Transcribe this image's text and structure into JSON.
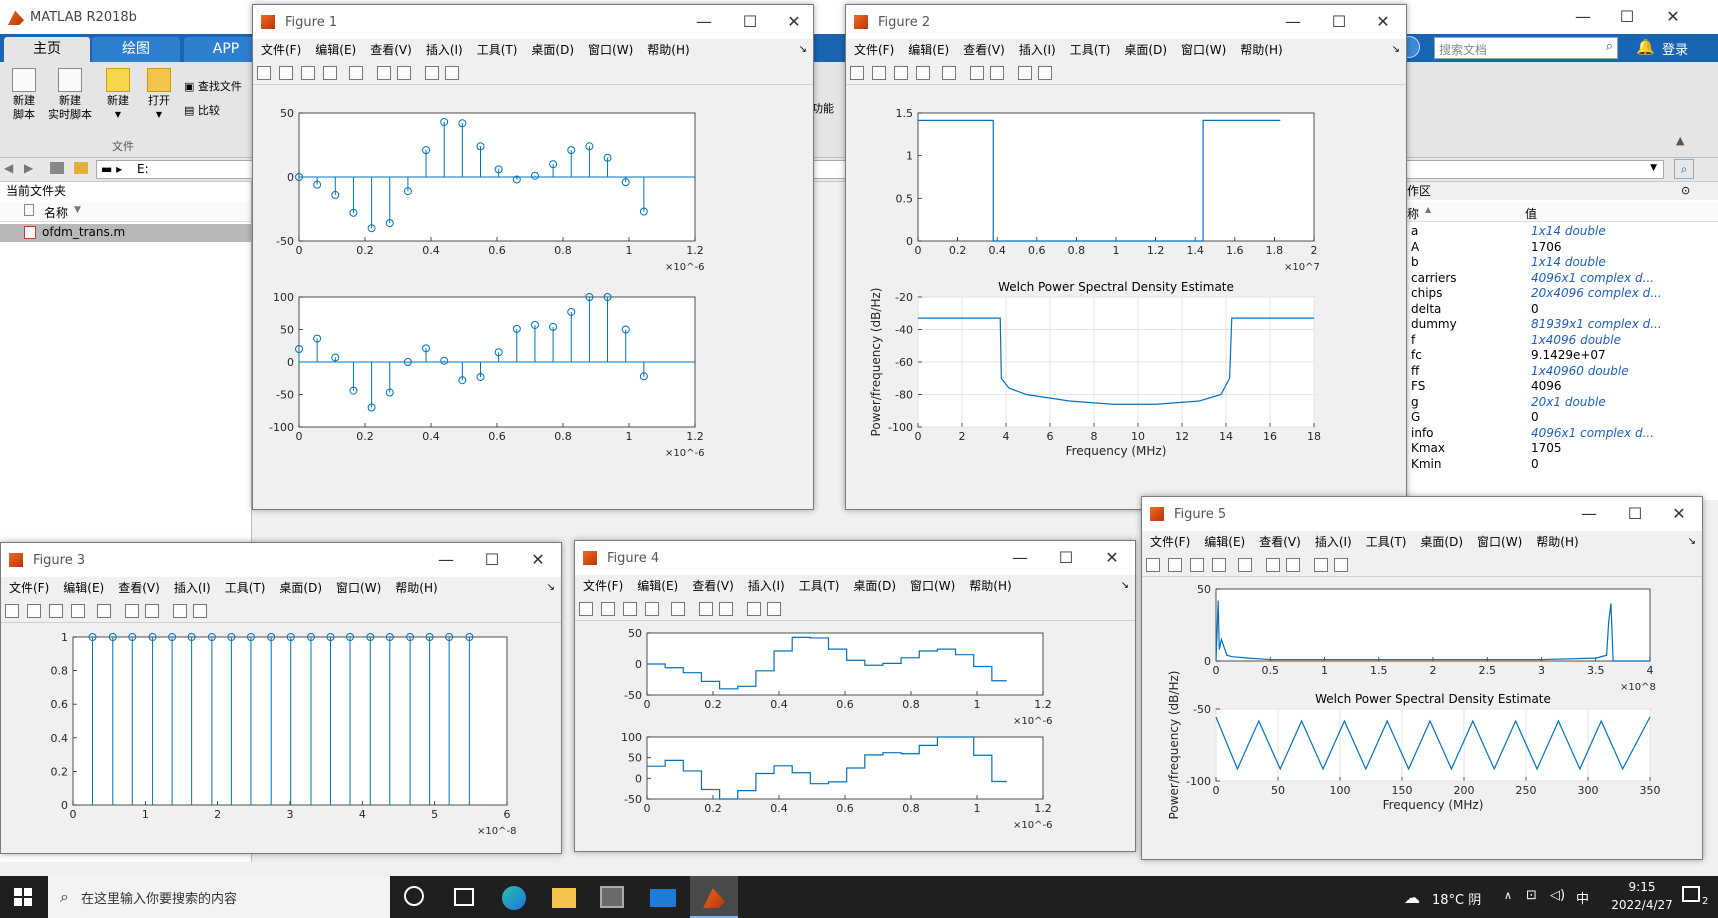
{
  "main": {
    "title": "MATLAB R2018b",
    "tabs": [
      "主页",
      "绘图",
      "APP"
    ],
    "ribbon": {
      "new_script": "新建\n脚本",
      "new_live": "新建\n实时脚本",
      "new": "新建",
      "open": "打开",
      "find_files": "查找文件",
      "compare": "比较",
      "section_file": "文件",
      "func_label": "功能"
    },
    "search_placeholder": "搜索文档",
    "login": "登录",
    "address": "E:",
    "current_folder": "当前文件夹",
    "col_name": "名称",
    "file": "ofdm_trans.m",
    "workspace": {
      "title": "作区",
      "col_name": "称",
      "col_value": "值",
      "rows": [
        {
          "n": "a",
          "v": "1x14 double",
          "it": true
        },
        {
          "n": "A",
          "v": "1706",
          "it": false
        },
        {
          "n": "b",
          "v": "1x14 double",
          "it": true
        },
        {
          "n": "carriers",
          "v": "4096x1 complex d...",
          "it": true
        },
        {
          "n": "chips",
          "v": "20x4096 complex d...",
          "it": true
        },
        {
          "n": "delta",
          "v": "0",
          "it": false
        },
        {
          "n": "dummy",
          "v": "81939x1 complex d...",
          "it": true
        },
        {
          "n": "f",
          "v": "1x4096 double",
          "it": true
        },
        {
          "n": "fc",
          "v": "9.1429e+07",
          "it": false
        },
        {
          "n": "ff",
          "v": "1x40960 double",
          "it": true
        },
        {
          "n": "FS",
          "v": "4096",
          "it": false
        },
        {
          "n": "g",
          "v": "20x1 double",
          "it": true
        },
        {
          "n": "G",
          "v": "0",
          "it": false
        },
        {
          "n": "info",
          "v": "4096x1 complex d...",
          "it": true
        },
        {
          "n": "Kmax",
          "v": "1705",
          "it": false
        },
        {
          "n": "Kmin",
          "v": "0",
          "it": false
        }
      ]
    }
  },
  "menu": [
    "文件(F)",
    "编辑(E)",
    "查看(V)",
    "插入(I)",
    "工具(T)",
    "桌面(D)",
    "窗口(W)",
    "帮助(H)"
  ],
  "figures": {
    "f1": {
      "title": "Figure 1"
    },
    "f2": {
      "title": "Figure 2"
    },
    "f3": {
      "title": "Figure 3"
    },
    "f4": {
      "title": "Figure 4"
    },
    "f5": {
      "title": "Figure 5"
    }
  },
  "taskbar": {
    "search_placeholder": "在这里输入你要搜索的内容",
    "weather": "18°C 阴",
    "ime": "中",
    "time": "9:15",
    "date": "2022/4/27",
    "notify": "2"
  },
  "chart_data": [
    {
      "type": "stem",
      "figure": "Figure 1",
      "panel": "top",
      "xlim": [
        0,
        1.2
      ],
      "ylim": [
        -50,
        50
      ],
      "x_exponent": "×10^-6",
      "xticks": [
        "0",
        "0.2",
        "0.4",
        "0.6",
        "0.8",
        "1",
        "1.2"
      ],
      "yticks": [
        "50",
        "0",
        "-50"
      ],
      "x": [
        0,
        0.055,
        0.11,
        0.165,
        0.22,
        0.275,
        0.33,
        0.385,
        0.44,
        0.495,
        0.55,
        0.605,
        0.66,
        0.715,
        0.77,
        0.825,
        0.88,
        0.935,
        0.99,
        1.045
      ],
      "values": [
        0,
        -6,
        -14,
        -28,
        -40,
        -36,
        -11,
        21,
        43,
        42,
        24,
        6,
        -2,
        1,
        10,
        21,
        24,
        15,
        -4,
        -27
      ]
    },
    {
      "type": "stem",
      "figure": "Figure 1",
      "panel": "bottom",
      "xlim": [
        0,
        1.2
      ],
      "ylim": [
        -100,
        100
      ],
      "x_exponent": "×10^-6",
      "xticks": [
        "0",
        "0.2",
        "0.4",
        "0.6",
        "0.8",
        "1",
        "1.2"
      ],
      "yticks": [
        "100",
        "50",
        "0",
        "-50",
        "-100"
      ],
      "x": [
        0,
        0.055,
        0.11,
        0.165,
        0.22,
        0.275,
        0.33,
        0.385,
        0.44,
        0.495,
        0.55,
        0.605,
        0.66,
        0.715,
        0.77,
        0.825,
        0.88,
        0.935,
        0.99,
        1.045
      ],
      "values": [
        20,
        36,
        7,
        -44,
        -70,
        -47,
        0,
        21,
        2,
        -28,
        -23,
        15,
        51,
        57,
        54,
        77,
        109,
        106,
        50,
        -22
      ]
    },
    {
      "type": "line",
      "figure": "Figure 2",
      "panel": "top",
      "xlim": [
        0,
        2
      ],
      "ylim": [
        0,
        1.5
      ],
      "x_exponent": "×10^7",
      "xticks": [
        "0",
        "0.2",
        "0.4",
        "0.6",
        "0.8",
        "1",
        "1.2",
        "1.4",
        "1.6",
        "1.8",
        "2"
      ],
      "yticks": [
        "1.5",
        "1",
        "0.5",
        "0"
      ],
      "x": [
        0,
        0.38,
        0.38,
        1.44,
        1.44,
        1.83
      ],
      "values": [
        1.414,
        1.414,
        0,
        0,
        1.414,
        1.414
      ]
    },
    {
      "type": "line",
      "figure": "Figure 2",
      "panel": "bottom",
      "title": "Welch Power Spectral Density Estimate",
      "xlabel": "Frequency (MHz)",
      "ylabel": "Power/frequency (dB/Hz)",
      "xlim": [
        0,
        18.3
      ],
      "ylim": [
        -100,
        -20
      ],
      "grid": true,
      "xticks": [
        "0",
        "2",
        "4",
        "6",
        "8",
        "10",
        "12",
        "14",
        "16",
        "18"
      ],
      "yticks": [
        "-20",
        "-40",
        "-60",
        "-80",
        "-100"
      ],
      "x": [
        0,
        3.8,
        3.85,
        4.2,
        5,
        7,
        9,
        11,
        13,
        14,
        14.4,
        14.5,
        18.3
      ],
      "values": [
        -33,
        -33,
        -70,
        -76,
        -80,
        -84,
        -86,
        -86,
        -84,
        -80,
        -70,
        -33,
        -33
      ]
    },
    {
      "type": "stem",
      "figure": "Figure 3",
      "xlim": [
        0,
        6
      ],
      "ylim": [
        0,
        1
      ],
      "x_exponent": "×10^-8",
      "xticks": [
        "0",
        "1",
        "2",
        "3",
        "4",
        "5",
        "6"
      ],
      "yticks": [
        "1",
        "0.8",
        "0.6",
        "0.4",
        "0.2",
        "0"
      ],
      "x": [
        0.27,
        0.55,
        0.82,
        1.1,
        1.37,
        1.64,
        1.92,
        2.19,
        2.46,
        2.74,
        3.01,
        3.29,
        3.56,
        3.83,
        4.11,
        4.38,
        4.66,
        4.93,
        5.2,
        5.48
      ],
      "values": [
        1,
        1,
        1,
        1,
        1,
        1,
        1,
        1,
        1,
        1,
        1,
        1,
        1,
        1,
        1,
        1,
        1,
        1,
        1,
        1
      ]
    },
    {
      "type": "stairs",
      "figure": "Figure 4",
      "panel": "top",
      "xlim": [
        0,
        1.2
      ],
      "ylim": [
        -50,
        50
      ],
      "x_exponent": "×10^-6",
      "xticks": [
        "0",
        "0.2",
        "0.4",
        "0.6",
        "0.8",
        "1",
        "1.2"
      ],
      "yticks": [
        "50",
        "0",
        "-50"
      ],
      "x": [
        0,
        0.055,
        0.11,
        0.165,
        0.22,
        0.275,
        0.33,
        0.385,
        0.44,
        0.495,
        0.55,
        0.605,
        0.66,
        0.715,
        0.77,
        0.825,
        0.88,
        0.935,
        0.99,
        1.045,
        1.09
      ],
      "values": [
        0,
        -6,
        -14,
        -28,
        -40,
        -36,
        -11,
        21,
        43,
        42,
        24,
        6,
        -2,
        1,
        10,
        21,
        24,
        15,
        -4,
        -27,
        -27
      ]
    },
    {
      "type": "stairs",
      "figure": "Figure 4",
      "panel": "bottom",
      "xlim": [
        0,
        1.2
      ],
      "ylim": [
        -70,
        100
      ],
      "x_exponent": "×10^-6",
      "xticks": [
        "0",
        "0.2",
        "0.4",
        "0.6",
        "0.8",
        "1",
        "1.2"
      ],
      "yticks": [
        "100",
        "50",
        "0",
        "-50"
      ],
      "x": [
        0,
        0.055,
        0.11,
        0.165,
        0.22,
        0.275,
        0.33,
        0.385,
        0.44,
        0.495,
        0.55,
        0.605,
        0.66,
        0.715,
        0.77,
        0.825,
        0.88,
        0.935,
        0.99,
        1.045,
        1.09
      ],
      "values": [
        20,
        36,
        7,
        -44,
        -70,
        -47,
        0,
        21,
        2,
        -28,
        -23,
        15,
        51,
        57,
        54,
        77,
        109,
        106,
        50,
        -22,
        -22
      ]
    },
    {
      "type": "line",
      "figure": "Figure 5",
      "panel": "top",
      "xlim": [
        0,
        4
      ],
      "ylim": [
        0,
        50
      ],
      "x_exponent": "×10^8",
      "xticks": [
        "0",
        "0.5",
        "1",
        "1.5",
        "2",
        "2.5",
        "3",
        "3.5",
        "4"
      ],
      "yticks": [
        "50",
        "0"
      ],
      "x": [
        0,
        0.02,
        0.03,
        0.05,
        0.1,
        0.15,
        0.3,
        0.5,
        1,
        1.5,
        2,
        2.5,
        3,
        3.5,
        3.6,
        3.62,
        3.64,
        3.66,
        4
      ],
      "values": [
        0,
        42,
        8,
        15,
        4,
        3,
        2,
        1,
        1,
        1,
        1,
        1,
        1,
        2,
        4,
        28,
        40,
        0,
        0
      ]
    },
    {
      "type": "line",
      "figure": "Figure 5",
      "panel": "bottom",
      "title": "Welch Power Spectral Density Estimate",
      "xlabel": "Frequency (MHz)",
      "ylabel": "Power/frequency (dB/Hz)",
      "xlim": [
        0,
        365
      ],
      "ylim": [
        -120,
        -30
      ],
      "grid": true,
      "xticks": [
        "0",
        "50",
        "100",
        "150",
        "200",
        "250",
        "300",
        "350"
      ],
      "yticks": [
        "-50",
        "-100"
      ],
      "x": [
        0,
        18,
        36,
        54,
        72,
        90,
        108,
        126,
        144,
        162,
        180,
        198,
        216,
        234,
        252,
        270,
        288,
        306,
        324,
        342,
        365
      ],
      "values": [
        -40,
        -105,
        -45,
        -105,
        -45,
        -105,
        -45,
        -105,
        -45,
        -105,
        -45,
        -105,
        -45,
        -105,
        -45,
        -105,
        -45,
        -105,
        -45,
        -105,
        -40
      ]
    }
  ]
}
